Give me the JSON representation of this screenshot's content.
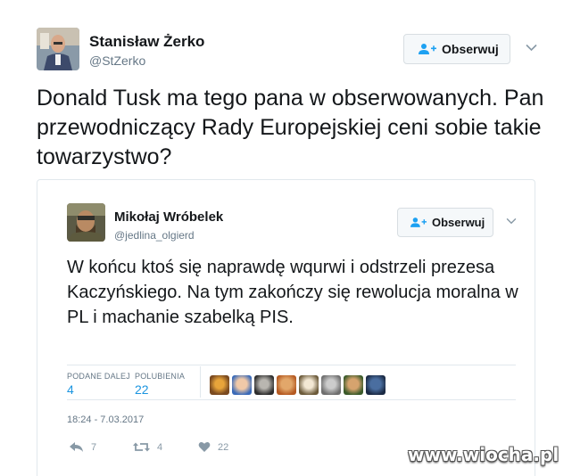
{
  "tweet": {
    "author": {
      "name": "Stanisław Żerko",
      "handle": "@StZerko",
      "avatar_icon": "user-photo"
    },
    "follow_label": "Obserwuj",
    "text": "Donald Tusk ma tego pana w obserwowanych. Pan przewodniczący Rady Europejskiej ceni sobie takie towarzystwo?"
  },
  "quoted": {
    "author": {
      "name": "Mikołaj Wróbelek",
      "handle": "@jedlina_olgierd",
      "avatar_icon": "user-photo"
    },
    "follow_label": "Obserwuj",
    "text": "W końcu ktoś się naprawdę wqurwi i odstrzeli prezesa Kaczyńskiego. Na tym zakończy się rewolucja moralna w PL i machanie szabelką PIS.",
    "stats": {
      "retweets_label": "PODANE DALEJ",
      "retweets": "4",
      "likes_label": "POLUBIENIA",
      "likes": "22"
    },
    "likers_count": 8,
    "timestamp": "18:24 - 7.03.2017",
    "actions": {
      "reply_count": "7",
      "retweet_count": "4",
      "like_count": "22"
    }
  },
  "watermark": "www.wiocha.pl",
  "colors": {
    "link": "#1b95e0",
    "muted": "#657786",
    "border": "#e1e8ed",
    "button_bg": "#f5f8fa"
  }
}
